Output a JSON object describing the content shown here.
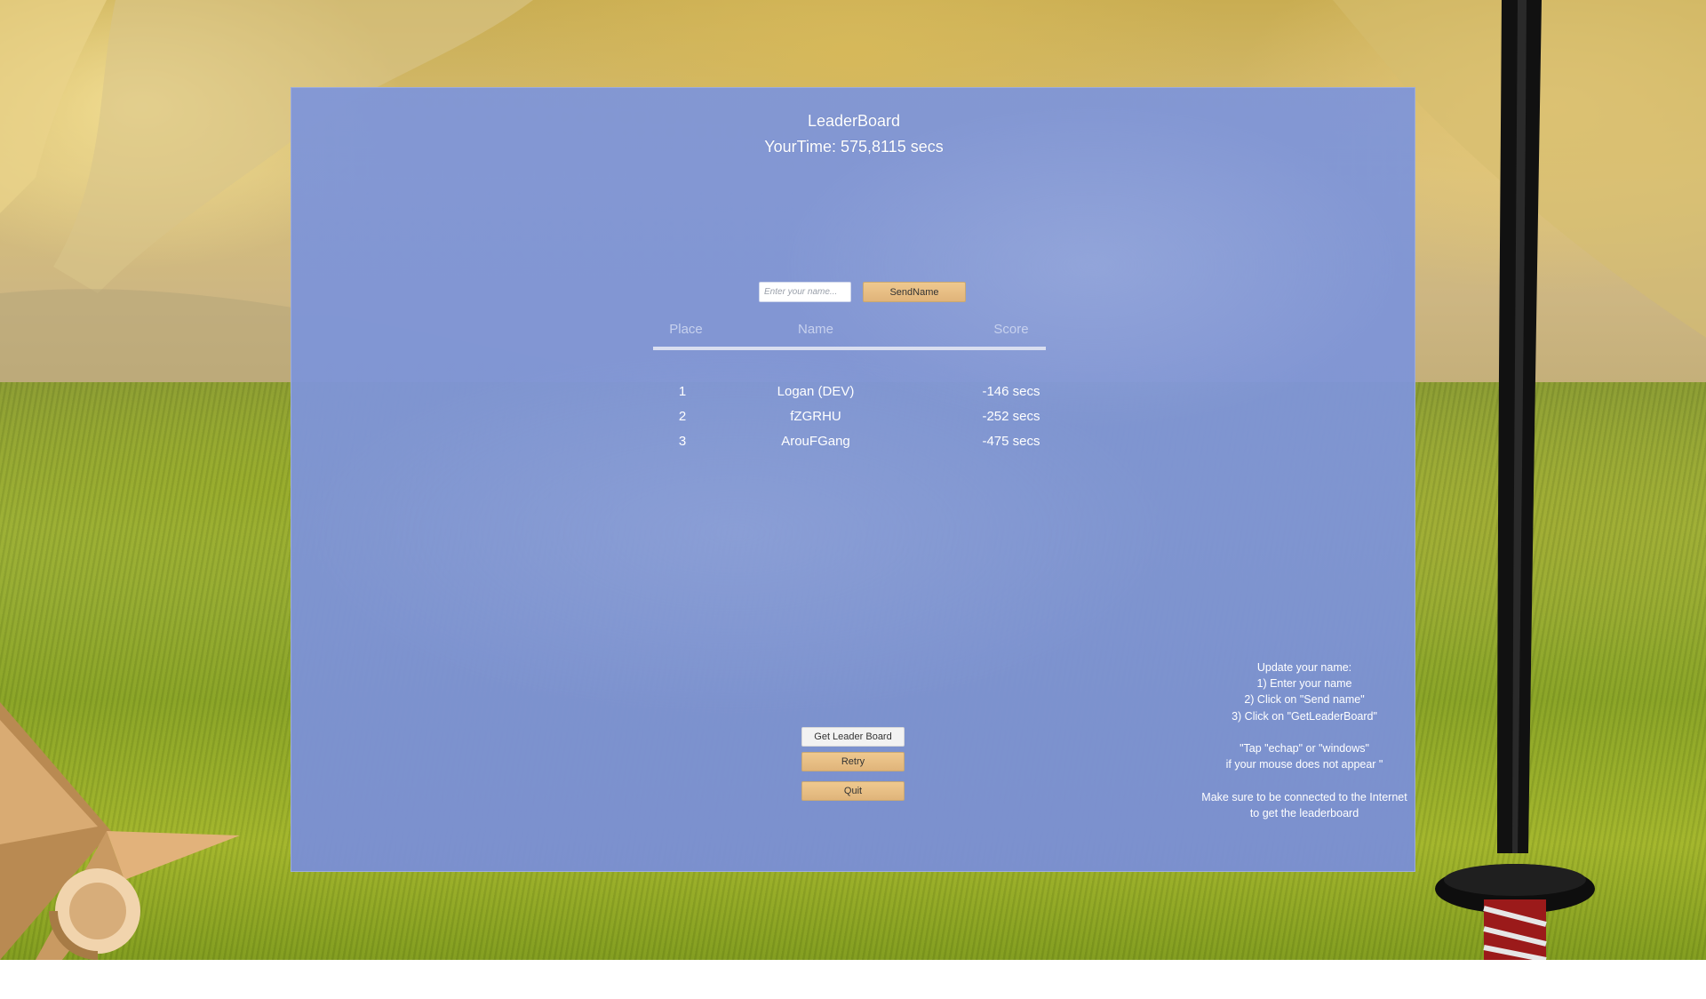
{
  "leaderboard": {
    "title": "LeaderBoard",
    "your_time": "YourTime: 575,8115 secs",
    "name_input": {
      "placeholder": "Enter your name...",
      "value": ""
    },
    "send_button": "SendName",
    "headers": {
      "place": "Place",
      "name": "Name",
      "score": "Score"
    },
    "rows": [
      {
        "place": "1",
        "name": "Logan (DEV)",
        "score": "-146 secs"
      },
      {
        "place": "2",
        "name": "fZGRHU",
        "score": "-252 secs"
      },
      {
        "place": "3",
        "name": "ArouFGang",
        "score": "-475 secs"
      }
    ],
    "buttons": {
      "get_leaderboard": "Get Leader Board",
      "retry": "Retry",
      "quit": "Quit"
    },
    "help_lines": [
      "Update your name:",
      "1) Enter your name",
      "2) Click on \"Send name\"",
      "3) Click on \"GetLeaderBoard\"",
      "",
      "\"Tap \"echap\" or \"windows\"",
      "if your mouse does not appear \"",
      "",
      "Make sure to be connected to the Internet",
      "to get the leaderboard"
    ]
  },
  "colors": {
    "panel": "#7f96d6",
    "button": "#e6bb80",
    "button_light": "#f2f2f2",
    "text": "#ffffff"
  },
  "icons": [
    "shuriken-icon",
    "katana-icon"
  ]
}
